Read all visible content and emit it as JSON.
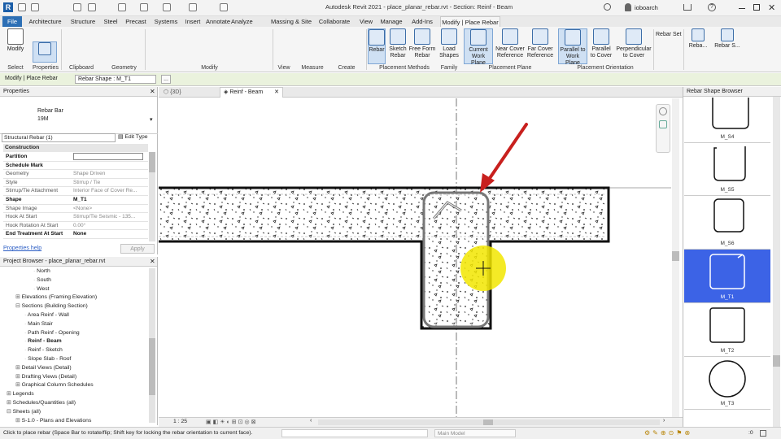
{
  "app": {
    "title": "Autodesk Revit 2021 - place_planar_rebar.rvt - Section: Reinf - Beam",
    "user": "ioboarch"
  },
  "tabs": [
    "File",
    "Architecture",
    "Structure",
    "Steel",
    "Precast",
    "Systems",
    "Insert",
    "Annotate",
    "Analyze",
    "Massing & Site",
    "Collaborate",
    "View",
    "Manage",
    "Add-Ins",
    "Modify | Place Rebar"
  ],
  "ribbon": {
    "select": {
      "modify": "Modify",
      "select": "Select",
      "properties": "Properties",
      "clipboard": "Clipboard",
      "geometry": "Geometry",
      "modify_group": "Modify",
      "view": "View",
      "measure": "Measure",
      "create": "Create"
    },
    "buttons": [
      {
        "label": "Rebar",
        "sel": true
      },
      {
        "label": "Sketch\nRebar"
      },
      {
        "label": "Free Form\nRebar"
      },
      {
        "label": "Load\nShapes"
      },
      {
        "label": "Current\nWork Plane",
        "sel": true
      },
      {
        "label": "Near Cover\nReference"
      },
      {
        "label": "Far Cover\nReference"
      },
      {
        "label": "Parallel to\nWork Plane",
        "sel": true
      },
      {
        "label": "Parallel\nto Cover"
      },
      {
        "label": "Perpendicular\nto Cover"
      }
    ],
    "groups": {
      "placement_methods": "Placement Methods",
      "family": "Family",
      "placement_plane": "Placement Plane",
      "placement_orientation": "Placement Orientation"
    },
    "rebar_set": "Rebar Set",
    "reba": "Reba...",
    "rebar_s": "Rebar S..."
  },
  "optbar": {
    "context": "Modify | Place Rebar",
    "shape_label": "Rebar Shape : M_T1",
    "more": "..."
  },
  "properties": {
    "header": "Properties",
    "type_name": "Rebar Bar",
    "type_size": "19M",
    "filter": "Structural Rebar (1)",
    "edit_type": "Edit Type",
    "section": "Construction",
    "rows": [
      {
        "k": "Partition",
        "v": "",
        "b": true
      },
      {
        "k": "Schedule Mark",
        "v": "",
        "b": true
      },
      {
        "k": "Geometry",
        "v": "Shape Driven"
      },
      {
        "k": "Style",
        "v": "Stirrup / Tie"
      },
      {
        "k": "Stirrup/Tie Attachment",
        "v": "Interior Face of Cover Re..."
      },
      {
        "k": "Shape",
        "v": "M_T1",
        "b": true
      },
      {
        "k": "Shape Image",
        "v": "<None>"
      },
      {
        "k": "Hook At Start",
        "v": "Stirrup/Tie Seismic - 135..."
      },
      {
        "k": "Hook Rotation At Start",
        "v": "0.00°"
      },
      {
        "k": "End Treatment At Start",
        "v": "None",
        "b": true
      }
    ],
    "help": "Properties help",
    "apply": "Apply"
  },
  "browser": {
    "header": "Project Browser - place_planar_rebar.rvt",
    "items": [
      {
        "t": "North",
        "l": 3
      },
      {
        "t": "South",
        "l": 3
      },
      {
        "t": "West",
        "l": 3
      },
      {
        "t": "Elevations (Framing Elevation)",
        "l": 1,
        "tw": "+"
      },
      {
        "t": "Sections (Building Section)",
        "l": 1,
        "tw": "-"
      },
      {
        "t": "Area Reinf - Wall",
        "l": 2
      },
      {
        "t": "Main Stair",
        "l": 2
      },
      {
        "t": "Path Reinf - Opening",
        "l": 2
      },
      {
        "t": "Reinf - Beam",
        "l": 2,
        "b": true
      },
      {
        "t": "Reinf - Sketch",
        "l": 2
      },
      {
        "t": "Slope Slab - Roof",
        "l": 2
      },
      {
        "t": "Detail Views (Detail)",
        "l": 1,
        "tw": "+"
      },
      {
        "t": "Drafting Views (Detail)",
        "l": 1,
        "tw": "+"
      },
      {
        "t": "Graphical Column Schedules",
        "l": 1,
        "tw": "+"
      },
      {
        "t": "Legends",
        "l": 0,
        "tw": "+"
      },
      {
        "t": "Schedules/Quantities (all)",
        "l": 0,
        "tw": "+"
      },
      {
        "t": "Sheets (all)",
        "l": 0,
        "tw": "-"
      },
      {
        "t": "S-1.0 - Plans and Elevations",
        "l": 1,
        "tw": "+"
      }
    ]
  },
  "viewtabs": {
    "tab3d": "{3D}",
    "tabbeam": "Reinf - Beam"
  },
  "viewctrl": {
    "scale": "1 : 25"
  },
  "shapes": {
    "header": "Rebar Shape Browser",
    "items": [
      "M_S4",
      "M_S5",
      "M_S6",
      "M_T1",
      "M_T2",
      "M_T3"
    ]
  },
  "status": {
    "text": "Click to place rebar (Space Bar to rotate/flip; Shift key for locking the rebar orientation to current face).",
    "model": "Main Model",
    "count": ":0"
  },
  "colors": {
    "accent": "#2c6fb5",
    "selected": "#3c63e6",
    "arrow": "#c8201e",
    "cursor": "#f2e600"
  }
}
